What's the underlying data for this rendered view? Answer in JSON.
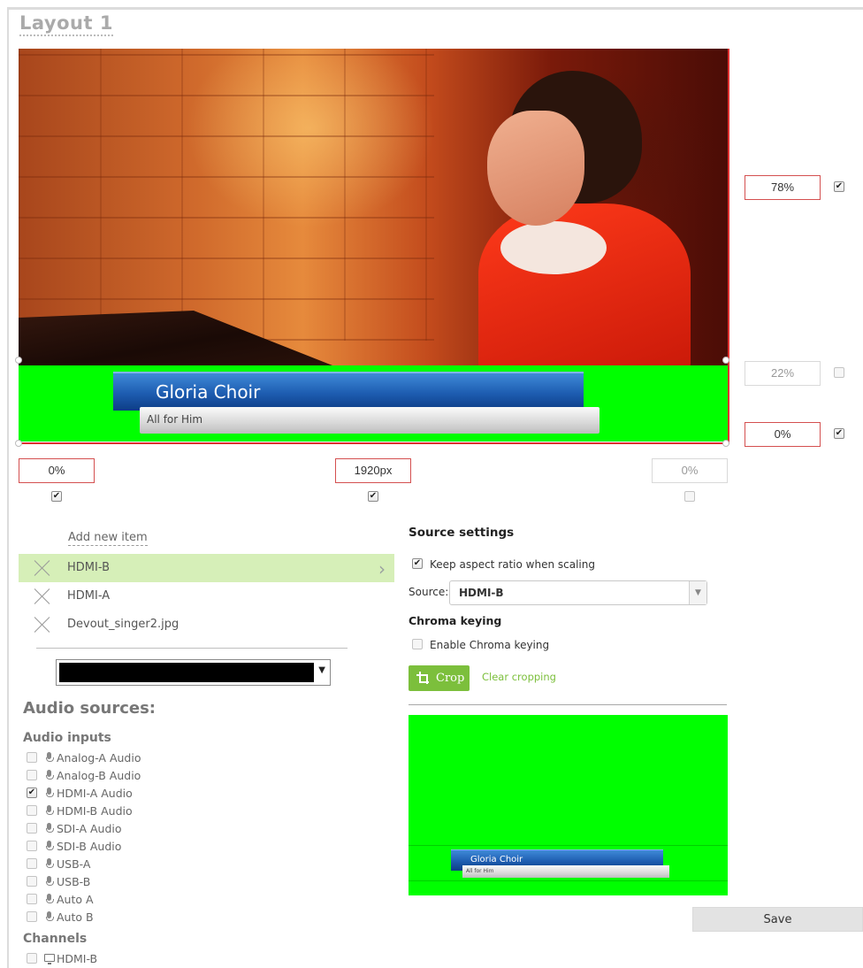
{
  "layout": {
    "title": "Layout 1"
  },
  "preview": {
    "lower_third_title": "Gloria Choir",
    "lower_third_subtitle": "All for Him",
    "background_color": "#00ff00"
  },
  "position": {
    "top": {
      "value": "78%",
      "checked": true
    },
    "height": {
      "value": "22%",
      "checked": false
    },
    "bottom": {
      "value": "0%",
      "checked": true
    },
    "left": {
      "value": "0%",
      "checked": true
    },
    "width": {
      "value": "1920px",
      "checked": true
    },
    "right": {
      "value": "0%",
      "checked": false
    }
  },
  "items": {
    "add_label": "Add new item",
    "list": [
      {
        "label": "HDMI-B",
        "active": true
      },
      {
        "label": "HDMI-A",
        "active": false
      },
      {
        "label": "Devout_singer2.jpg",
        "active": false
      }
    ],
    "background_color_value": "#000000"
  },
  "audio": {
    "heading": "Audio sources:",
    "inputs_heading": "Audio inputs",
    "inputs": [
      {
        "label": "Analog-A Audio",
        "checked": false
      },
      {
        "label": "Analog-B Audio",
        "checked": false
      },
      {
        "label": "HDMI-A Audio",
        "checked": true
      },
      {
        "label": "HDMI-B Audio",
        "checked": false
      },
      {
        "label": "SDI-A Audio",
        "checked": false
      },
      {
        "label": "SDI-B Audio",
        "checked": false
      },
      {
        "label": "USB-A",
        "checked": false
      },
      {
        "label": "USB-B",
        "checked": false
      },
      {
        "label": "Auto A",
        "checked": false
      },
      {
        "label": "Auto B",
        "checked": false
      }
    ],
    "channels_heading": "Channels",
    "channels": [
      {
        "label": "HDMI-B",
        "checked": false
      }
    ]
  },
  "source_settings": {
    "heading": "Source settings",
    "keep_aspect_label": "Keep aspect ratio when scaling",
    "keep_aspect_checked": true,
    "source_label": "Source:",
    "source_value": "HDMI-B",
    "chroma_heading": "Chroma keying",
    "chroma_enable_label": "Enable Chroma keying",
    "chroma_enabled": false,
    "crop_label": "Crop",
    "clear_cropping_label": "Clear cropping",
    "thumb_title": "Gloria Choir",
    "thumb_subtitle": "All for Him"
  },
  "save_label": "Save",
  "colors": {
    "accent_green": "#7cbf3c",
    "active_row": "#d6efb8",
    "field_border": "#d45050"
  }
}
